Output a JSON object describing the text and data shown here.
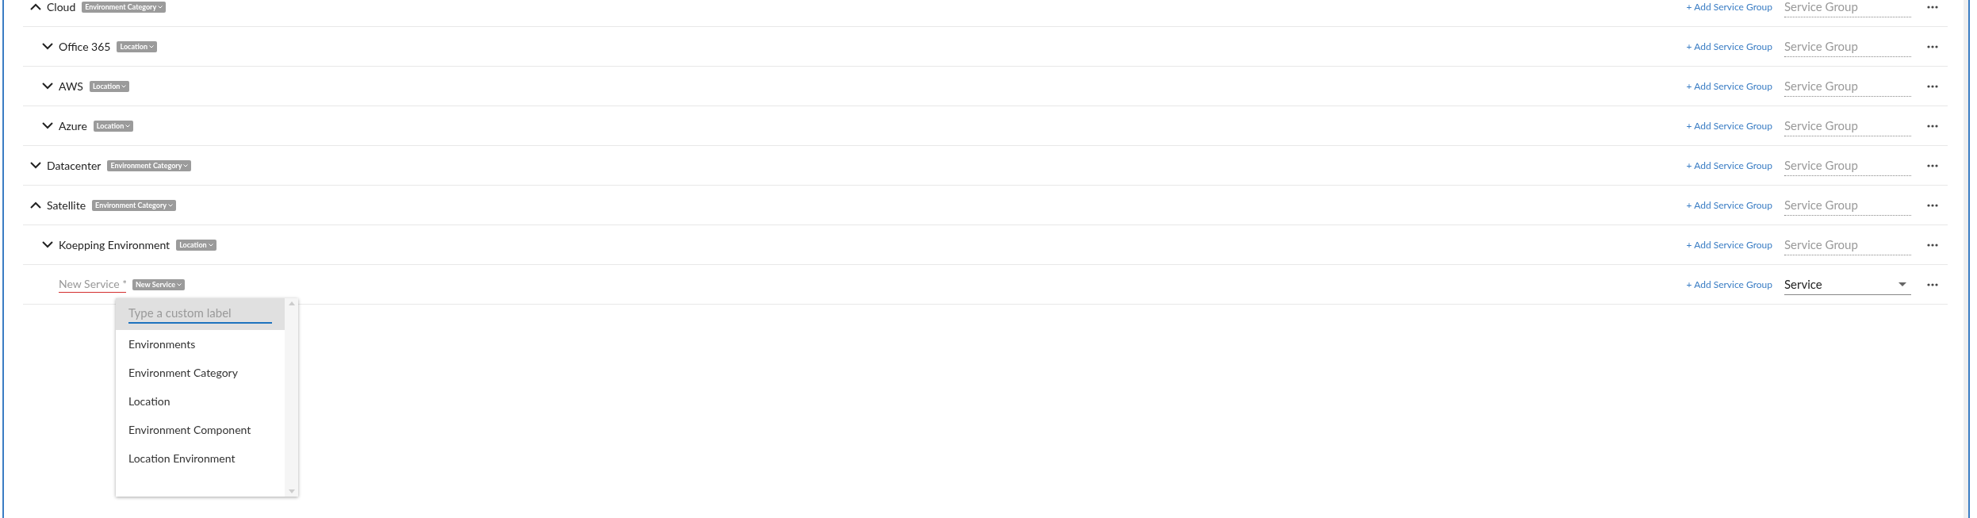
{
  "tree": [
    {
      "kind": "group",
      "name": "Cloud",
      "expanded": true,
      "tag": "Environment Category",
      "add_link": "+ Add Service Group",
      "field": {
        "placeholder": "Service Group"
      },
      "children": [
        {
          "kind": "group",
          "name": "Office 365",
          "expanded": false,
          "tag": "Location",
          "add_link": "+ Add Service Group",
          "field": {
            "placeholder": "Service Group"
          }
        },
        {
          "kind": "group",
          "name": "AWS",
          "expanded": false,
          "tag": "Location",
          "add_link": "+ Add Service Group",
          "field": {
            "placeholder": "Service Group"
          }
        },
        {
          "kind": "group",
          "name": "Azure",
          "expanded": false,
          "tag": "Location",
          "add_link": "+ Add Service Group",
          "field": {
            "placeholder": "Service Group"
          }
        }
      ]
    },
    {
      "kind": "group",
      "name": "Datacenter",
      "expanded": false,
      "tag": "Environment Category",
      "add_link": "+ Add Service Group",
      "field": {
        "placeholder": "Service Group"
      }
    },
    {
      "kind": "group",
      "name": "Satellite",
      "expanded": true,
      "tag": "Environment Category",
      "add_link": "+ Add Service Group",
      "field": {
        "placeholder": "Service Group"
      },
      "children": [
        {
          "kind": "group",
          "name": "Koepping Environment",
          "expanded": false,
          "tag": "Location",
          "add_link": "+ Add Service Group",
          "field": {
            "placeholder": "Service Group"
          }
        },
        {
          "kind": "new",
          "name_field": {
            "placeholder": "New Service *"
          },
          "tag": "New Service",
          "add_link": "+ Add Service Group",
          "select": {
            "value": "Service"
          },
          "menu": {
            "search": {
              "placeholder": "Type a custom label"
            },
            "options": [
              "Environments",
              "Environment Category",
              "Location",
              "Environment Component",
              "Location Environment"
            ]
          }
        }
      ]
    }
  ]
}
